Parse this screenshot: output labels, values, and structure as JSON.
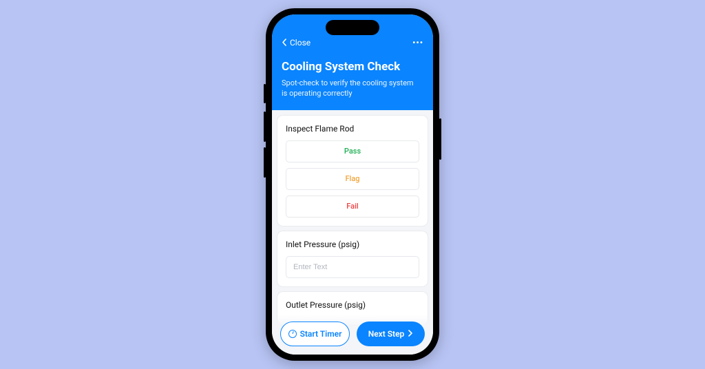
{
  "header": {
    "close_label": "Close",
    "title": "Cooling System Check",
    "subtitle": "Spot-check to verify the cooling system is operating correctly"
  },
  "cards": {
    "flame_rod": {
      "title": "Inspect Flame Rod",
      "options": {
        "pass": "Pass",
        "flag": "Flag",
        "fail": "Fail"
      }
    },
    "inlet": {
      "title": "Inlet Pressure (psig)",
      "placeholder": "Enter Text"
    },
    "outlet": {
      "title": "Outlet Pressure (psig)"
    }
  },
  "footer": {
    "start_timer": "Start Timer",
    "next_step": "Next Step"
  }
}
